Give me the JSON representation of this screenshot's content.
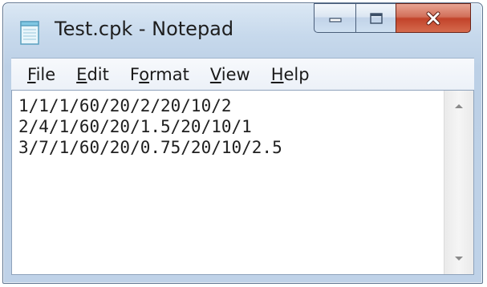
{
  "window": {
    "title": "Test.cpk - Notepad",
    "accent_close": "#c2432a"
  },
  "menu": {
    "items": [
      {
        "label_u": "F",
        "label_rest": "ile"
      },
      {
        "label_u": "E",
        "label_rest": "dit"
      },
      {
        "label_pre": "F",
        "label_u": "o",
        "label_rest": "rmat"
      },
      {
        "label_u": "V",
        "label_rest": "iew"
      },
      {
        "label_u": "H",
        "label_rest": "elp"
      }
    ]
  },
  "document": {
    "lines": [
      "1/1/1/60/20/2/20/10/2",
      "2/4/1/60/20/1.5/20/10/1",
      "3/7/1/60/20/0.75/20/10/2.5"
    ]
  },
  "icons": {
    "app": "notepad-icon",
    "minimize": "minimize-icon",
    "maximize": "maximize-icon",
    "close": "close-icon",
    "scroll_up": "scroll-up-arrow-icon",
    "scroll_down": "scroll-down-arrow-icon"
  }
}
